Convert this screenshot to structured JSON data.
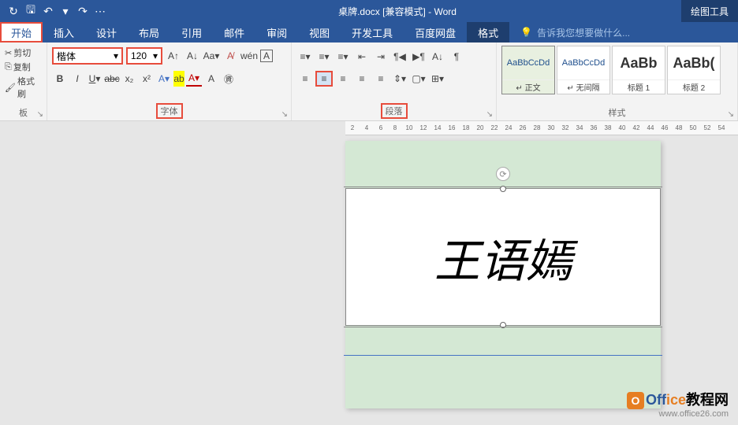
{
  "title": {
    "filename": "桌牌.docx",
    "mode": "[兼容模式]",
    "app": "Word",
    "context": "绘图工具"
  },
  "qat": {
    "refresh": "↻",
    "save": "💾",
    "undo": "↶",
    "redo": "↷",
    "more": "▾"
  },
  "tabs": {
    "start": "开始",
    "insert": "插入",
    "design": "设计",
    "layout": "布局",
    "references": "引用",
    "mail": "邮件",
    "review": "审阅",
    "view": "视图",
    "dev": "开发工具",
    "baidu": "百度网盘",
    "format": "格式",
    "tellme": "告诉我您想要做什么..."
  },
  "clipboard": {
    "cut": "剪切",
    "copy": "复制",
    "painter": "格式刷",
    "label": "板"
  },
  "font": {
    "name": "楷体",
    "size": "120",
    "label": "字体"
  },
  "paragraph": {
    "label": "段落"
  },
  "styles": {
    "label": "样式",
    "items": [
      {
        "preview": "AaBbCcDd",
        "name": "↵ 正文",
        "big": false
      },
      {
        "preview": "AaBbCcDd",
        "name": "↵ 无间隔",
        "big": false
      },
      {
        "preview": "AaBb",
        "name": "标题 1",
        "big": true
      },
      {
        "preview": "AaBb(",
        "name": "标题 2",
        "big": true
      }
    ]
  },
  "ruler": [
    "2",
    "4",
    "6",
    "8",
    "10",
    "12",
    "14",
    "16",
    "18",
    "20",
    "22",
    "24",
    "26",
    "28",
    "30",
    "32",
    "34",
    "36",
    "38",
    "40",
    "42",
    "44",
    "46",
    "48",
    "50",
    "52",
    "54"
  ],
  "document": {
    "text": "王语嫣"
  },
  "watermark": {
    "brand_o": "O",
    "brand1": "Off",
    "brand2": "ice",
    "brand3": "教程网",
    "url": "www.office26.com"
  }
}
